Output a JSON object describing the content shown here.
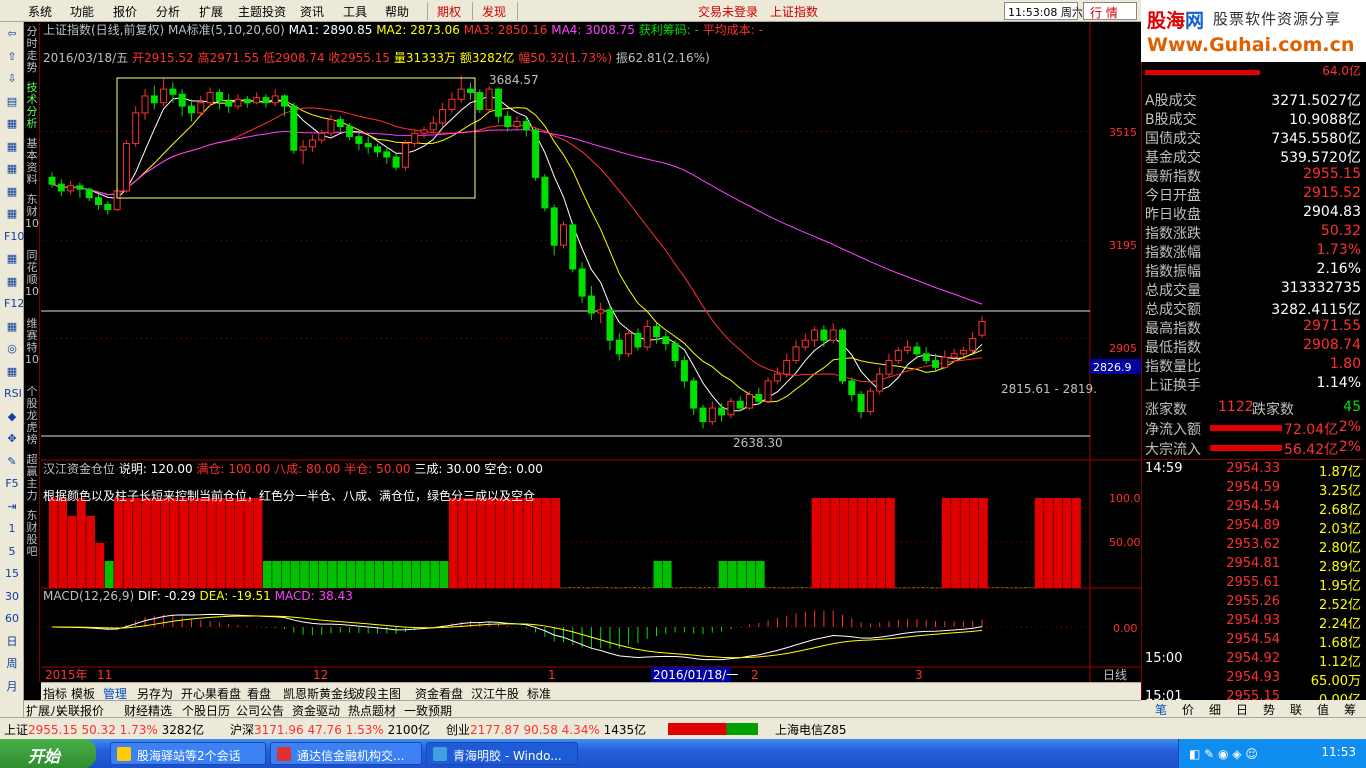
{
  "menu": {
    "items": [
      "系统",
      "功能",
      "报价",
      "分析",
      "扩展",
      "主题投资",
      "资讯",
      "工具",
      "帮助"
    ],
    "rights_btn": "期权",
    "discover_btn": "发现",
    "login_status": "交易未登录",
    "index_name": "上证指数",
    "clock": "11:53:08 周六",
    "quote_tab": "行  情"
  },
  "logo": {
    "brand_a": "股海",
    "brand_b": "网",
    "slogan": "股票软件资源分享",
    "url": "Www.Guhai.com.cn"
  },
  "side_tabs": [
    {
      "label": "分时走势",
      "active": false
    },
    {
      "label": "技术分析",
      "active": true
    },
    {
      "label": "基本资料",
      "active": false
    },
    {
      "label": "东财10",
      "active": false
    },
    {
      "label": "同花顺10",
      "active": false
    },
    {
      "label": "维赛特10",
      "active": false
    },
    {
      "label": "个股龙虎榜",
      "active": false
    },
    {
      "label": "超赢主力",
      "active": false
    },
    {
      "label": "东财股吧",
      "active": false
    }
  ],
  "left_icons": [
    "⇦",
    "⇧",
    "⇩",
    "▤",
    "▦",
    "▦",
    "▦",
    "▦",
    "▦",
    "F10",
    "▦",
    "▦",
    "F12",
    "▦",
    "◎",
    "▦",
    "RSI",
    "◆",
    "✥",
    "✎",
    "F5",
    "⇥",
    "1",
    "5",
    "15",
    "30",
    "60",
    "日",
    "周",
    "月"
  ],
  "chart": {
    "header": {
      "title": "上证指数(日线,前复权)",
      "ma_label": "MA标准(5,10,20,60)",
      "ma1": "MA1: 2890.85",
      "ma2": "MA2: 2873.06",
      "ma3": "MA3: 2850.16",
      "ma4": "MA4: 3008.75",
      "profit": "获利筹码: -",
      "avgcost": "平均成本: -"
    },
    "ohlc_line": {
      "date": "2016/03/18/五",
      "open": "开2915.52",
      "high": "高2971.55",
      "low": "低2908.74",
      "close": "收2955.15",
      "vol": "量31333万",
      "amount": "额3282亿",
      "change": "幅50.32(1.73%)",
      "amp": "振62.81(2.16%)"
    },
    "price_axis": [
      "3515",
      "3195",
      "2905"
    ],
    "cursor_price": "2826.9",
    "annotations": {
      "high": "3684.57",
      "low": "2638.30",
      "range": "2815.61 - 2819."
    },
    "indicator": {
      "name": "汉江资金仓位",
      "desc": "说明: 120.00",
      "full": "满仓: 100.00",
      "eighty": "八成: 80.00",
      "half": "半仓: 50.00",
      "thirty": "三成: 30.00",
      "empty": "空仓: 0.00",
      "note": "根据颜色以及柱子长短来控制当前仓位，红色分一半仓、八成、满仓位，绿色分三成以及空仓",
      "axis": [
        "100.0",
        "50.00"
      ]
    },
    "macd": {
      "name": "MACD(12,26,9)",
      "dif": "DIF: -0.29",
      "dea": "DEA: -19.51",
      "macd": "MACD: 38.43",
      "axis": "0.00"
    },
    "time_axis": [
      "2015年",
      "11",
      "12",
      "1",
      "2",
      "3"
    ],
    "cursor_date": "2016/01/18/一",
    "period": "日线"
  },
  "bottom_tabs": [
    "指标",
    "模板",
    "管理",
    "另存为",
    "开心果看盘",
    "看盘",
    "凯恩斯黄金线",
    "波段主图",
    "资金看盘",
    "汉江牛股",
    "标准"
  ],
  "bottom_tabs2": [
    "扩展八",
    "关联报价",
    "财经精选",
    "个股日历",
    "公司公告",
    "资金驱动",
    "热点题材",
    "一致预期"
  ],
  "right_panel": {
    "top_value": "64.0亿",
    "stats": [
      {
        "label": "A股成交",
        "value": "3271.5027亿",
        "color": "white"
      },
      {
        "label": "B股成交",
        "value": "10.9088亿",
        "color": "white"
      },
      {
        "label": "国债成交",
        "value": "7345.5580亿",
        "color": "white"
      },
      {
        "label": "基金成交",
        "value": "539.5720亿",
        "color": "white"
      },
      {
        "label": "最新指数",
        "value": "2955.15",
        "color": "red"
      },
      {
        "label": "今日开盘",
        "value": "2915.52",
        "color": "red"
      },
      {
        "label": "昨日收盘",
        "value": "2904.83",
        "color": "white"
      },
      {
        "label": "指数涨跌",
        "value": "50.32",
        "color": "red"
      },
      {
        "label": "指数涨幅",
        "value": "1.73%",
        "color": "red"
      },
      {
        "label": "指数振幅",
        "value": "2.16%",
        "color": "white"
      },
      {
        "label": "总成交量",
        "value": "313332735",
        "color": "white"
      },
      {
        "label": "总成交额",
        "value": "3282.4115亿",
        "color": "white"
      },
      {
        "label": "最高指数",
        "value": "2971.55",
        "color": "red"
      },
      {
        "label": "最低指数",
        "value": "2908.74",
        "color": "red"
      },
      {
        "label": "指数量比",
        "value": "1.80",
        "color": "red"
      },
      {
        "label": "上证换手",
        "value": "1.14%",
        "color": "white"
      }
    ],
    "updown": {
      "up_label": "涨家数",
      "up": "1122",
      "down_label": "跌家数",
      "down": "45"
    },
    "flows": [
      {
        "label": "净流入额",
        "value": "72.04亿",
        "pct": "2%"
      },
      {
        "label": "大宗流入",
        "value": "56.42亿",
        "pct": "2%"
      }
    ],
    "ticks": [
      {
        "time": "14:59",
        "price": "2954.33",
        "vol": "1.87亿"
      },
      {
        "time": "",
        "price": "2954.59",
        "vol": "3.25亿"
      },
      {
        "time": "",
        "price": "2954.54",
        "vol": "2.68亿"
      },
      {
        "time": "",
        "price": "2954.89",
        "vol": "2.03亿"
      },
      {
        "time": "",
        "price": "2953.62",
        "vol": "2.80亿"
      },
      {
        "time": "",
        "price": "2954.81",
        "vol": "2.89亿"
      },
      {
        "time": "",
        "price": "2955.61",
        "vol": "1.95亿"
      },
      {
        "time": "",
        "price": "2955.26",
        "vol": "2.52亿"
      },
      {
        "time": "",
        "price": "2954.93",
        "vol": "2.24亿"
      },
      {
        "time": "",
        "price": "2954.54",
        "vol": "1.68亿"
      },
      {
        "time": "15:00",
        "price": "2954.92",
        "vol": "1.12亿"
      },
      {
        "time": "",
        "price": "2954.93",
        "vol": "65.00万"
      },
      {
        "time": "15:01",
        "price": "2955.15",
        "vol": "0.00亿"
      }
    ],
    "tabs": [
      "笔",
      "价",
      "细",
      "日",
      "势",
      "联",
      "值",
      "筹"
    ]
  },
  "status": {
    "sh_label": "上证",
    "sh_val": "2955.15",
    "sh_chg": "50.32",
    "sh_pct": "1.73%",
    "sh_amt": "3282亿",
    "sz_label": "沪深",
    "sz_val": "3171.96",
    "sz_chg": "47.76",
    "sz_pct": "1.53%",
    "sz_amt": "2100亿",
    "cy_label": "创业",
    "cy_val": "2177.87",
    "cy_chg": "90.58",
    "cy_pct": "4.34%",
    "cy_amt": "1435亿",
    "server": "上海电信Z85"
  },
  "taskbar": {
    "start": "开始",
    "tasks": [
      "股海驿站等2个会话",
      "通达信金融机构交...",
      "青海明胶 - Windo..."
    ],
    "clock": "11:53"
  },
  "chart_data": {
    "type": "candlestick",
    "title": "上证指数(日线,前复权)",
    "price_ticks": [
      3515,
      3195,
      2905
    ],
    "ylim": [
      2600,
      3720
    ],
    "candles": [
      [
        3380,
        3360,
        3395,
        3350
      ],
      [
        3360,
        3340,
        3375,
        3325
      ],
      [
        3340,
        3355,
        3370,
        3330
      ],
      [
        3355,
        3345,
        3365,
        3320
      ],
      [
        3345,
        3320,
        3350,
        3310
      ],
      [
        3320,
        3300,
        3330,
        3285
      ],
      [
        3300,
        3285,
        3310,
        3270
      ],
      [
        3285,
        3340,
        3345,
        3280
      ],
      [
        3340,
        3480,
        3490,
        3335
      ],
      [
        3480,
        3570,
        3590,
        3470
      ],
      [
        3570,
        3620,
        3640,
        3550
      ],
      [
        3620,
        3600,
        3650,
        3580
      ],
      [
        3600,
        3640,
        3670,
        3590
      ],
      [
        3640,
        3625,
        3660,
        3600
      ],
      [
        3625,
        3590,
        3640,
        3560
      ],
      [
        3590,
        3570,
        3610,
        3545
      ],
      [
        3570,
        3600,
        3620,
        3560
      ],
      [
        3600,
        3630,
        3645,
        3590
      ],
      [
        3630,
        3605,
        3640,
        3580
      ],
      [
        3605,
        3590,
        3625,
        3570
      ],
      [
        3590,
        3610,
        3625,
        3580
      ],
      [
        3610,
        3600,
        3620,
        3585
      ],
      [
        3600,
        3615,
        3630,
        3595
      ],
      [
        3615,
        3600,
        3625,
        3585
      ],
      [
        3600,
        3620,
        3640,
        3590
      ],
      [
        3620,
        3590,
        3625,
        3560
      ],
      [
        3590,
        3460,
        3600,
        3450
      ],
      [
        3460,
        3470,
        3490,
        3420
      ],
      [
        3470,
        3490,
        3505,
        3455
      ],
      [
        3490,
        3510,
        3520,
        3480
      ],
      [
        3510,
        3550,
        3565,
        3500
      ],
      [
        3550,
        3530,
        3560,
        3515
      ],
      [
        3530,
        3500,
        3540,
        3490
      ],
      [
        3500,
        3480,
        3510,
        3460
      ],
      [
        3480,
        3470,
        3500,
        3450
      ],
      [
        3470,
        3455,
        3480,
        3440
      ],
      [
        3455,
        3440,
        3470,
        3420
      ],
      [
        3440,
        3410,
        3450,
        3400
      ],
      [
        3410,
        3480,
        3490,
        3400
      ],
      [
        3480,
        3510,
        3520,
        3470
      ],
      [
        3510,
        3520,
        3530,
        3495
      ],
      [
        3520,
        3540,
        3560,
        3510
      ],
      [
        3540,
        3580,
        3600,
        3530
      ],
      [
        3580,
        3610,
        3630,
        3570
      ],
      [
        3610,
        3640,
        3680,
        3600
      ],
      [
        3640,
        3630,
        3660,
        3610
      ],
      [
        3630,
        3580,
        3640,
        3570
      ],
      [
        3580,
        3640,
        3650,
        3575
      ],
      [
        3640,
        3560,
        3645,
        3540
      ],
      [
        3560,
        3530,
        3575,
        3515
      ],
      [
        3530,
        3545,
        3560,
        3520
      ],
      [
        3545,
        3520,
        3555,
        3500
      ],
      [
        3520,
        3380,
        3525,
        3370
      ],
      [
        3380,
        3290,
        3390,
        3280
      ],
      [
        3290,
        3180,
        3300,
        3150
      ],
      [
        3180,
        3240,
        3250,
        3170
      ],
      [
        3240,
        3110,
        3245,
        3100
      ],
      [
        3110,
        3030,
        3130,
        3010
      ],
      [
        3030,
        2980,
        3060,
        2960
      ],
      [
        2980,
        2990,
        3010,
        2950
      ],
      [
        2990,
        2900,
        3000,
        2870
      ],
      [
        2900,
        2860,
        2920,
        2840
      ],
      [
        2860,
        2920,
        2930,
        2850
      ],
      [
        2920,
        2880,
        2935,
        2870
      ],
      [
        2880,
        2940,
        2960,
        2870
      ],
      [
        2940,
        2910,
        2950,
        2890
      ],
      [
        2910,
        2890,
        2925,
        2870
      ],
      [
        2890,
        2840,
        2900,
        2820
      ],
      [
        2840,
        2780,
        2855,
        2760
      ],
      [
        2780,
        2700,
        2790,
        2680
      ],
      [
        2700,
        2660,
        2710,
        2640
      ],
      [
        2660,
        2700,
        2720,
        2650
      ],
      [
        2700,
        2680,
        2715,
        2660
      ],
      [
        2680,
        2720,
        2730,
        2670
      ],
      [
        2720,
        2700,
        2735,
        2690
      ],
      [
        2700,
        2740,
        2750,
        2695
      ],
      [
        2740,
        2720,
        2760,
        2710
      ],
      [
        2720,
        2780,
        2790,
        2715
      ],
      [
        2780,
        2800,
        2820,
        2770
      ],
      [
        2800,
        2840,
        2860,
        2790
      ],
      [
        2840,
        2880,
        2900,
        2830
      ],
      [
        2880,
        2900,
        2920,
        2870
      ],
      [
        2900,
        2930,
        2940,
        2880
      ],
      [
        2930,
        2900,
        2945,
        2880
      ],
      [
        2900,
        2930,
        2950,
        2890
      ],
      [
        2930,
        2780,
        2935,
        2770
      ],
      [
        2780,
        2740,
        2790,
        2720
      ],
      [
        2740,
        2690,
        2750,
        2670
      ],
      [
        2690,
        2750,
        2760,
        2680
      ],
      [
        2750,
        2800,
        2820,
        2740
      ],
      [
        2800,
        2840,
        2860,
        2790
      ],
      [
        2840,
        2870,
        2880,
        2830
      ],
      [
        2870,
        2880,
        2900,
        2860
      ],
      [
        2880,
        2860,
        2895,
        2845
      ],
      [
        2860,
        2840,
        2880,
        2830
      ],
      [
        2840,
        2820,
        2860,
        2810
      ],
      [
        2820,
        2850,
        2870,
        2815
      ],
      [
        2850,
        2860,
        2875,
        2840
      ],
      [
        2860,
        2870,
        2880,
        2850
      ],
      [
        2870,
        2905,
        2925,
        2860
      ],
      [
        2915,
        2955,
        2971,
        2908
      ]
    ],
    "position_bars": [
      100,
      100,
      80,
      100,
      80,
      50,
      30,
      100,
      100,
      100,
      100,
      100,
      100,
      100,
      100,
      100,
      100,
      100,
      100,
      100,
      100,
      100,
      100,
      30,
      30,
      30,
      30,
      30,
      30,
      30,
      30,
      30,
      30,
      30,
      30,
      30,
      30,
      30,
      30,
      30,
      30,
      30,
      30,
      100,
      100,
      100,
      100,
      100,
      100,
      100,
      100,
      100,
      100,
      100,
      100,
      0,
      0,
      0,
      0,
      0,
      0,
      0,
      0,
      0,
      0,
      30,
      30,
      0,
      0,
      0,
      0,
      0,
      30,
      30,
      30,
      30,
      30,
      0,
      0,
      0,
      0,
      0,
      100,
      100,
      100,
      100,
      100,
      100,
      100,
      100,
      100,
      0,
      0,
      0,
      0,
      0,
      100,
      100,
      100,
      100,
      100,
      0,
      0,
      0,
      0,
      0,
      100,
      100,
      120,
      120,
      120
    ]
  }
}
